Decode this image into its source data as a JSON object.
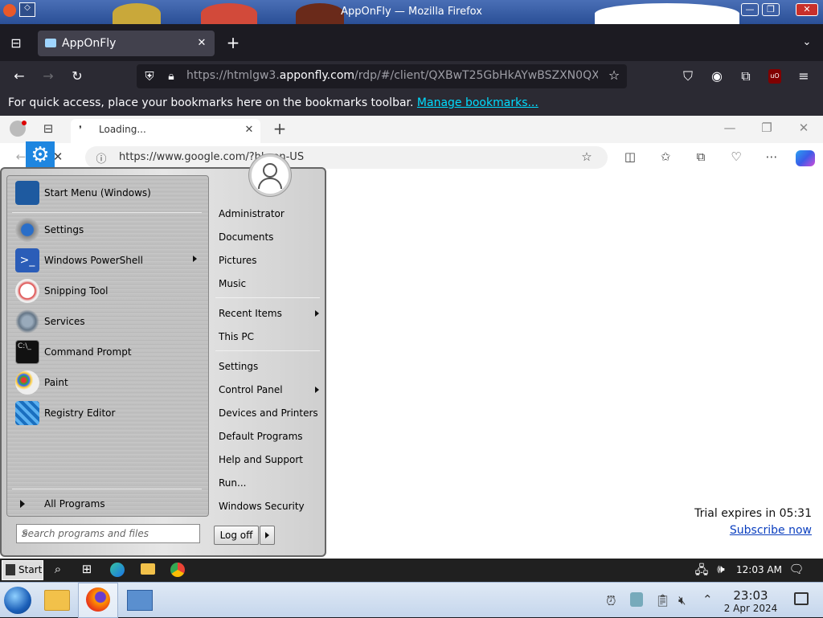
{
  "os": {
    "window_title": "AppOnFly — Mozilla Firefox"
  },
  "firefox": {
    "tab_title": "AppOnFly",
    "url_prefix": "https://htmlgw3.",
    "url_domain": "apponfly.com",
    "url_suffix": "/rdp/#/client/QXBwT25GbHkAYwBSZXN0QX",
    "bookmarks_message": "For quick access, place your bookmarks here on the bookmarks toolbar.",
    "bookmarks_link": "Manage bookmarks..."
  },
  "edge": {
    "tab_title": "Loading...",
    "url": "https://www.google.com/?hl=en-US"
  },
  "start_menu": {
    "left_items": [
      {
        "label": "Start Menu (Windows)",
        "icon": "start-menu-icon"
      },
      {
        "label": "Settings",
        "icon": "settings-gear-icon"
      },
      {
        "label": "Windows PowerShell",
        "icon": "powershell-icon",
        "submenu": true
      },
      {
        "label": "Snipping Tool",
        "icon": "snipping-tool-icon"
      },
      {
        "label": "Services",
        "icon": "services-gears-icon"
      },
      {
        "label": "Command Prompt",
        "icon": "command-prompt-icon"
      },
      {
        "label": "Paint",
        "icon": "paint-palette-icon"
      },
      {
        "label": "Registry Editor",
        "icon": "registry-editor-icon"
      }
    ],
    "all_programs": "All Programs",
    "search_placeholder": "Search programs and files",
    "right_items": {
      "administrator": "Administrator",
      "documents": "Documents",
      "pictures": "Pictures",
      "music": "Music",
      "recent_items": "Recent Items",
      "this_pc": "This PC",
      "settings": "Settings",
      "control_panel": "Control Panel",
      "devices_printers": "Devices and Printers",
      "default_programs": "Default Programs",
      "help_support": "Help and Support",
      "run": "Run...",
      "windows_security": "Windows Security"
    },
    "log_off": "Log off"
  },
  "trial": {
    "text": "Trial expires in 05:31",
    "link": "Subscribe now"
  },
  "remote_taskbar": {
    "start_label": "Start",
    "time": "12:03 AM"
  },
  "host_taskbar": {
    "time": "23:03",
    "date": "2 Apr 2024"
  }
}
